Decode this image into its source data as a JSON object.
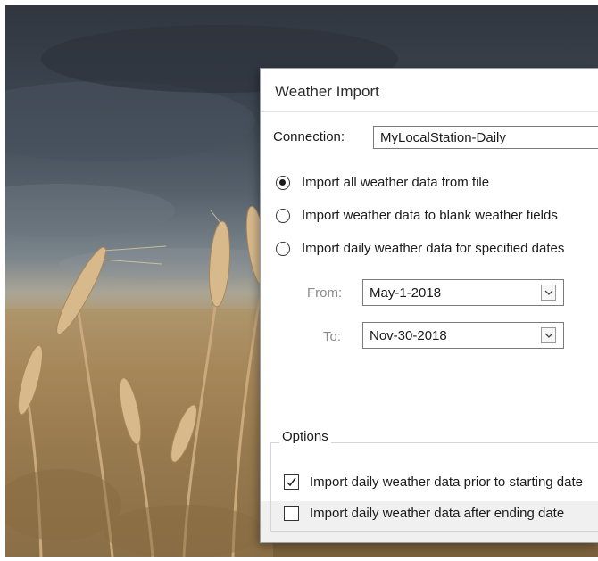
{
  "dialog": {
    "title": "Weather Import",
    "connection_label": "Connection:",
    "connection_value": "MyLocalStation-Daily"
  },
  "import_mode": {
    "options": [
      {
        "label": "Import all weather data from file",
        "selected": true
      },
      {
        "label": "Import weather data to blank weather fields",
        "selected": false
      },
      {
        "label": "Import daily weather data for specified dates",
        "selected": false
      }
    ]
  },
  "date_range": {
    "from_label": "From:",
    "from_value": "May-1-2018",
    "to_label": "To:",
    "to_value": "Nov-30-2018"
  },
  "options": {
    "legend": "Options",
    "items": [
      {
        "label": "Import daily weather data prior to starting date",
        "checked": true
      },
      {
        "label": "Import daily weather data after ending date",
        "checked": false
      }
    ]
  },
  "colors": {
    "dialog_bg": "#f0f0f0",
    "client_bg": "#ffffff",
    "border": "#7a7a7a"
  }
}
